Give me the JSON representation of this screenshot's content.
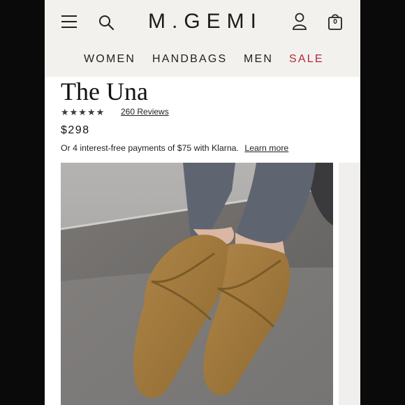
{
  "header": {
    "logo": "M.GEMI",
    "bag_count": "0",
    "nav": [
      "WOMEN",
      "HANDBAGS",
      "MEN",
      "SALE"
    ]
  },
  "product": {
    "title": "The Una",
    "rating_stars": "★★★★★",
    "reviews": "260 Reviews",
    "price": "$298",
    "klarna_text": "Or 4 interest-free payments of $75 with Klarna.",
    "learn_more": "Learn more"
  },
  "icons": [
    "menu-icon",
    "search-icon",
    "account-icon",
    "bag-icon"
  ],
  "colors": {
    "header_bg": "#f3f1ee",
    "sale": "#b5283b",
    "shoe": "#a07a3c",
    "leggings": "#5f6471"
  }
}
